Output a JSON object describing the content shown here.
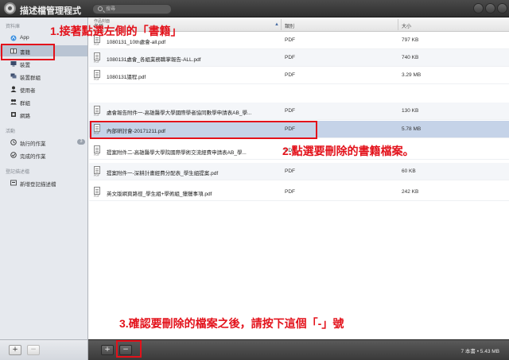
{
  "titlebar": {
    "title": "描述檔管理程式",
    "search_placeholder": "搜尋"
  },
  "sidebar": {
    "sections": [
      {
        "label": "資料庫"
      },
      {
        "label": "活動"
      },
      {
        "label": "登記描述檔"
      }
    ],
    "items": [
      {
        "label": "App",
        "icon": "app-store-icon"
      },
      {
        "label": "書籍",
        "icon": "book-icon"
      },
      {
        "label": "裝置",
        "icon": "device-icon"
      },
      {
        "label": "裝置群組",
        "icon": "device-group-icon"
      },
      {
        "label": "使用者",
        "icon": "user-icon"
      },
      {
        "label": "群組",
        "icon": "group-icon"
      },
      {
        "label": "網路",
        "icon": "network-icon"
      },
      {
        "label": "執行的作業",
        "icon": "clock-icon",
        "badge": "3"
      },
      {
        "label": "完成的作業",
        "icon": "check-icon"
      },
      {
        "label": "新增登記描述檔",
        "icon": "enroll-profile-icon"
      }
    ]
  },
  "table": {
    "columns": {
      "top_label": "作品封面",
      "name": "名稱",
      "type": "類別",
      "size": "大小"
    },
    "icon_label": "PDF",
    "rows": [
      {
        "name": "1080131_10th處會-all.pdf",
        "type": "PDF",
        "size": "797 KB"
      },
      {
        "name": "1080131處會_各組業務職掌報告-ALL.pdf",
        "type": "PDF",
        "size": "740 KB"
      },
      {
        "name": "1080131議程.pdf",
        "type": "PDF",
        "size": "3.29 MB"
      },
      {
        "name": "處會報告附件一-高雄醫學大學國際學者協同數學申請表AB_學...",
        "type": "PDF",
        "size": "130 KB"
      },
      {
        "name": "內部研討會-20171211.pdf",
        "type": "PDF",
        "size": "5.78 MB"
      },
      {
        "name": "提案附件二-高雄醫學大學院國際學術交流經費申請表AB_學...",
        "type": "PDF",
        "size": ""
      },
      {
        "name": "提案附件一-深耕計畫經費分配表_學生組提案.pdf",
        "type": "PDF",
        "size": "60 KB"
      },
      {
        "name": "英文版網頁路徑_學生組+學術組_獵獵事項.pdf",
        "type": "PDF",
        "size": "242 KB"
      }
    ]
  },
  "bottombar": {
    "add_label": "+",
    "remove_label": "−",
    "status": "7 本書 • 5.43 MB"
  },
  "annotations": {
    "step1": "1.接著點選左側的「書籍」",
    "step2": "2.點選要刪除的書籍檔案。",
    "step3": "3.確認要刪除的檔案之後，請按下這個「-」號",
    "color": "#e3121b"
  }
}
